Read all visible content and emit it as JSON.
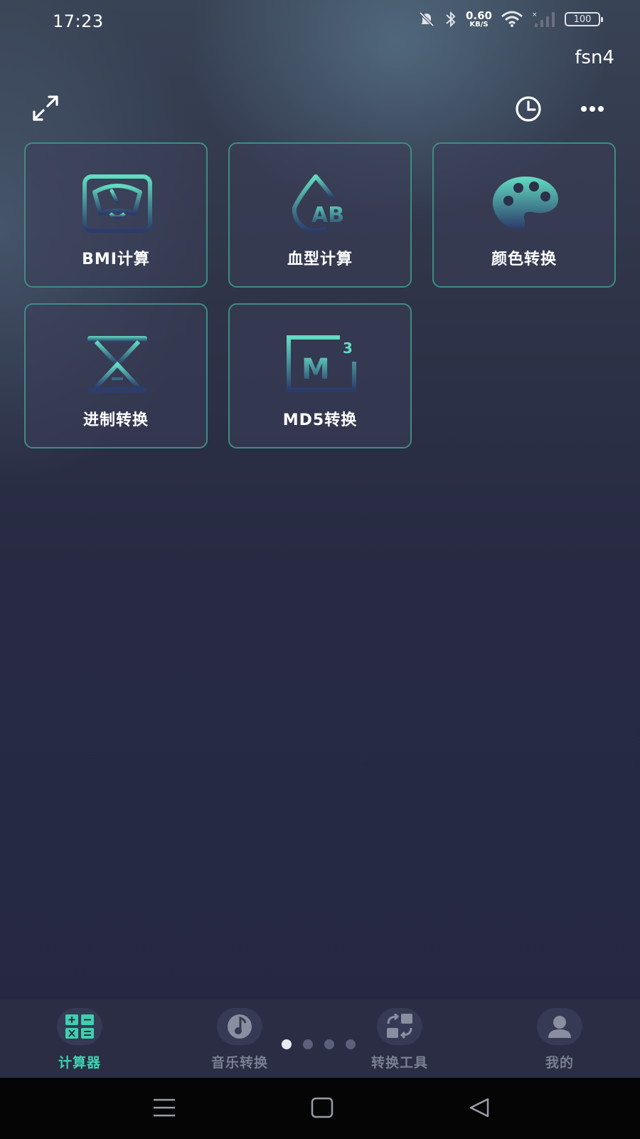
{
  "status_bar": {
    "time": "17:23",
    "net_speed_value": "0.60",
    "net_speed_unit": "KB/S",
    "battery": "100"
  },
  "header": {
    "user_name": "fsn4",
    "icons": [
      "expand-icon",
      "history-icon",
      "more-icon"
    ]
  },
  "tools": [
    {
      "label": "BMI计算",
      "icon": "scale-icon"
    },
    {
      "label": "血型计算",
      "icon": "blood-drop-icon"
    },
    {
      "label": "颜色转换",
      "icon": "palette-icon"
    },
    {
      "label": "进制转换",
      "icon": "hourglass-icon"
    },
    {
      "label": "MD5转换",
      "icon": "md5-icon"
    }
  ],
  "tabbar": {
    "tabs": [
      {
        "label": "计算器",
        "icon": "calculator-icon",
        "active": true
      },
      {
        "label": "音乐转换",
        "icon": "music-disc-icon",
        "active": false
      },
      {
        "label": "转换工具",
        "icon": "convert-icon",
        "active": false
      },
      {
        "label": "我的",
        "icon": "user-icon",
        "active": false
      }
    ],
    "page_indicator": {
      "count": 4,
      "active_index": 0
    }
  },
  "colors": {
    "accent": "#3fd0b0",
    "card_border": "#3f8c82",
    "icon_gradient_top": "#5fdcc0",
    "icon_gradient_bottom": "#2a3a6a"
  }
}
